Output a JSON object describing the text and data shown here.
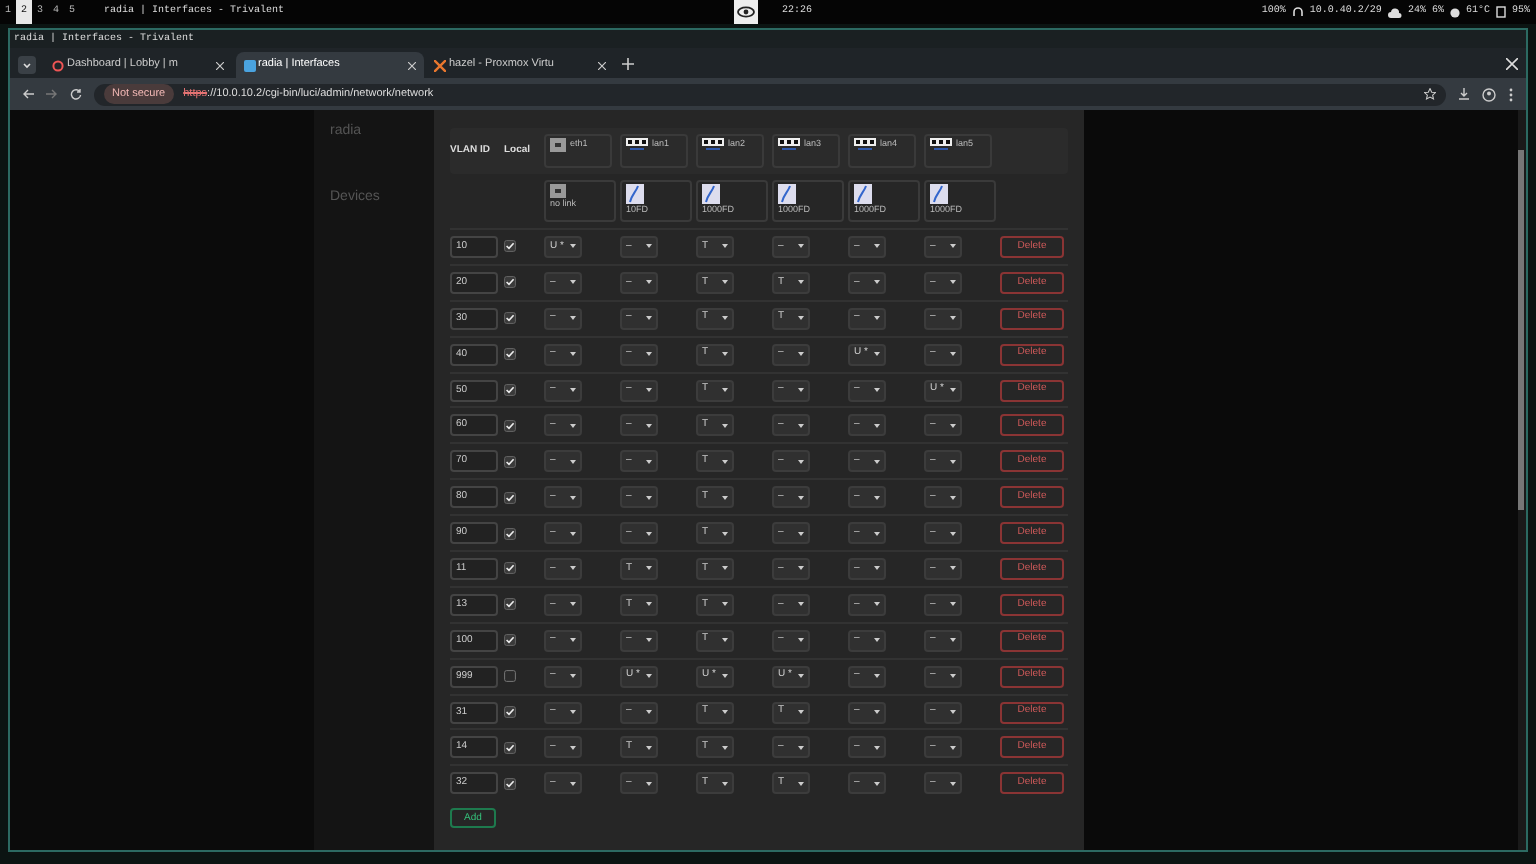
{
  "topbar": {
    "workspaces": [
      {
        "label": "1",
        "selected": false
      },
      {
        "label": "2",
        "selected": true
      },
      {
        "label": "3",
        "selected": false
      },
      {
        "label": "4",
        "selected": false
      },
      {
        "label": "5",
        "selected": false
      }
    ],
    "title": "radia | Interfaces - Trivalent",
    "clock": "22:26",
    "status": [
      "100%",
      "10.0.40.2/29",
      "24%",
      "6%",
      "61°C",
      "95%"
    ]
  },
  "window": {
    "title": "radia | Interfaces - Trivalent"
  },
  "browser_tabs": [
    {
      "label": "Dashboard | Lobby | m",
      "selected": false
    },
    {
      "label": "radia | Interfaces",
      "selected": true
    },
    {
      "label": "hazel - Proxmox Virtu",
      "selected": false
    }
  ],
  "address_bar": {
    "security": "Not secure",
    "scheme": "https",
    "url": "://10.0.10.2/cgi-bin/luci/admin/network/network"
  },
  "page": {
    "brand": "radia",
    "section": "Devices"
  },
  "vlan_table": {
    "columns": [
      "VLAN ID",
      "Local"
    ],
    "ports": [
      {
        "name": "eth1",
        "kind": "plain",
        "status": "no link"
      },
      {
        "name": "lan1",
        "kind": "lan",
        "status": "10FD"
      },
      {
        "name": "lan2",
        "kind": "lan",
        "status": "1000FD"
      },
      {
        "name": "lan3",
        "kind": "lan",
        "status": "1000FD"
      },
      {
        "name": "lan4",
        "kind": "lan",
        "status": "1000FD"
      },
      {
        "name": "lan5",
        "kind": "lan",
        "status": "1000FD"
      }
    ],
    "rows": [
      {
        "vlan_id": "10",
        "local": true,
        "ports": [
          "U *",
          "–",
          "T",
          "–",
          "–",
          "–"
        ],
        "delete": "Delete"
      },
      {
        "vlan_id": "20",
        "local": true,
        "ports": [
          "–",
          "–",
          "T",
          "T",
          "–",
          "–"
        ],
        "delete": "Delete"
      },
      {
        "vlan_id": "30",
        "local": true,
        "ports": [
          "–",
          "–",
          "T",
          "T",
          "–",
          "–"
        ],
        "delete": "Delete"
      },
      {
        "vlan_id": "40",
        "local": true,
        "ports": [
          "–",
          "–",
          "T",
          "–",
          "U *",
          "–"
        ],
        "delete": "Delete"
      },
      {
        "vlan_id": "50",
        "local": true,
        "ports": [
          "–",
          "–",
          "T",
          "–",
          "–",
          "U *"
        ],
        "delete": "Delete"
      },
      {
        "vlan_id": "60",
        "local": true,
        "ports": [
          "–",
          "–",
          "T",
          "–",
          "–",
          "–"
        ],
        "delete": "Delete"
      },
      {
        "vlan_id": "70",
        "local": true,
        "ports": [
          "–",
          "–",
          "T",
          "–",
          "–",
          "–"
        ],
        "delete": "Delete"
      },
      {
        "vlan_id": "80",
        "local": true,
        "ports": [
          "–",
          "–",
          "T",
          "–",
          "–",
          "–"
        ],
        "delete": "Delete"
      },
      {
        "vlan_id": "90",
        "local": true,
        "ports": [
          "–",
          "–",
          "T",
          "–",
          "–",
          "–"
        ],
        "delete": "Delete"
      },
      {
        "vlan_id": "11",
        "local": true,
        "ports": [
          "–",
          "T",
          "T",
          "–",
          "–",
          "–"
        ],
        "delete": "Delete"
      },
      {
        "vlan_id": "13",
        "local": true,
        "ports": [
          "–",
          "T",
          "T",
          "–",
          "–",
          "–"
        ],
        "delete": "Delete"
      },
      {
        "vlan_id": "100",
        "local": true,
        "ports": [
          "–",
          "–",
          "T",
          "–",
          "–",
          "–"
        ],
        "delete": "Delete"
      },
      {
        "vlan_id": "999",
        "local": false,
        "ports": [
          "–",
          "U *",
          "U *",
          "U *",
          "–",
          "–"
        ],
        "delete": "Delete"
      },
      {
        "vlan_id": "31",
        "local": true,
        "ports": [
          "–",
          "–",
          "T",
          "T",
          "–",
          "–"
        ],
        "delete": "Delete"
      },
      {
        "vlan_id": "14",
        "local": true,
        "ports": [
          "–",
          "T",
          "T",
          "–",
          "–",
          "–"
        ],
        "delete": "Delete"
      },
      {
        "vlan_id": "32",
        "local": true,
        "ports": [
          "–",
          "–",
          "T",
          "T",
          "–",
          "–"
        ],
        "delete": "Delete"
      }
    ],
    "add_label": "Add"
  }
}
